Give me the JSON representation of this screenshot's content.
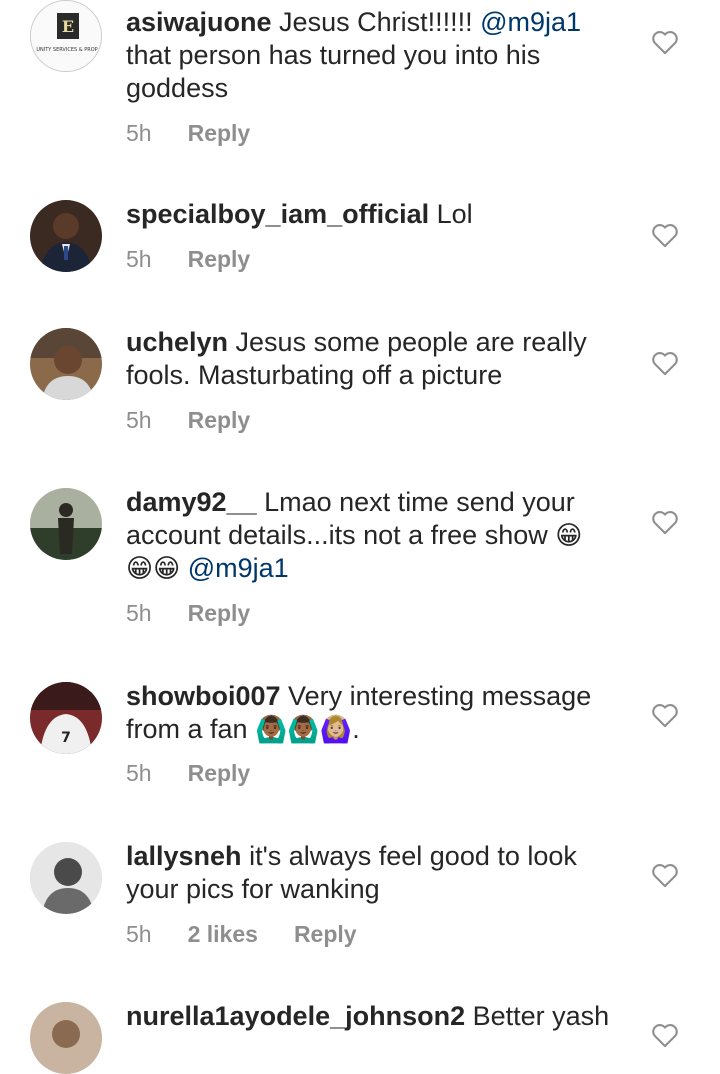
{
  "comments": [
    {
      "username": "asiwajuone",
      "text": " Jesus Christ!!!!!! ",
      "mention": "@m9ja1",
      "text2": " that person  has turned you into his goddess",
      "time": "5h",
      "reply": "Reply",
      "avatar_text": "UNITY SERVICES & PROP"
    },
    {
      "username": "specialboy_iam_official",
      "text": " Lol",
      "time": "5h",
      "reply": "Reply"
    },
    {
      "username": "uchelyn",
      "text": " Jesus some people are really fools. Masturbating off a picture",
      "time": "5h",
      "reply": "Reply"
    },
    {
      "username": "damy92__",
      "text": " Lmao next time send your account details...its not a free show ",
      "emoji": "😁",
      "emoji2": "😁😁",
      "mention": "@m9ja1",
      "time": "5h",
      "reply": "Reply"
    },
    {
      "username": "showboi007",
      "text": " Very interesting message from a fan ",
      "emoji": "🙆🏾‍♂️🙆🏾‍♂️🙆🏼‍♀️",
      "tail": ".",
      "time": "5h",
      "reply": "Reply"
    },
    {
      "username": "lallysneh",
      "text": " it's always feel good to look your pics for wanking",
      "time": "5h",
      "likes": "2 likes",
      "reply": "Reply"
    },
    {
      "username": "nurella1ayodele_johnson2",
      "text": " Better yash"
    }
  ],
  "icons": {
    "like": "heart-outline-icon"
  },
  "colors": {
    "text": "#262626",
    "meta": "#8e8e8e",
    "mention": "#00376b"
  }
}
